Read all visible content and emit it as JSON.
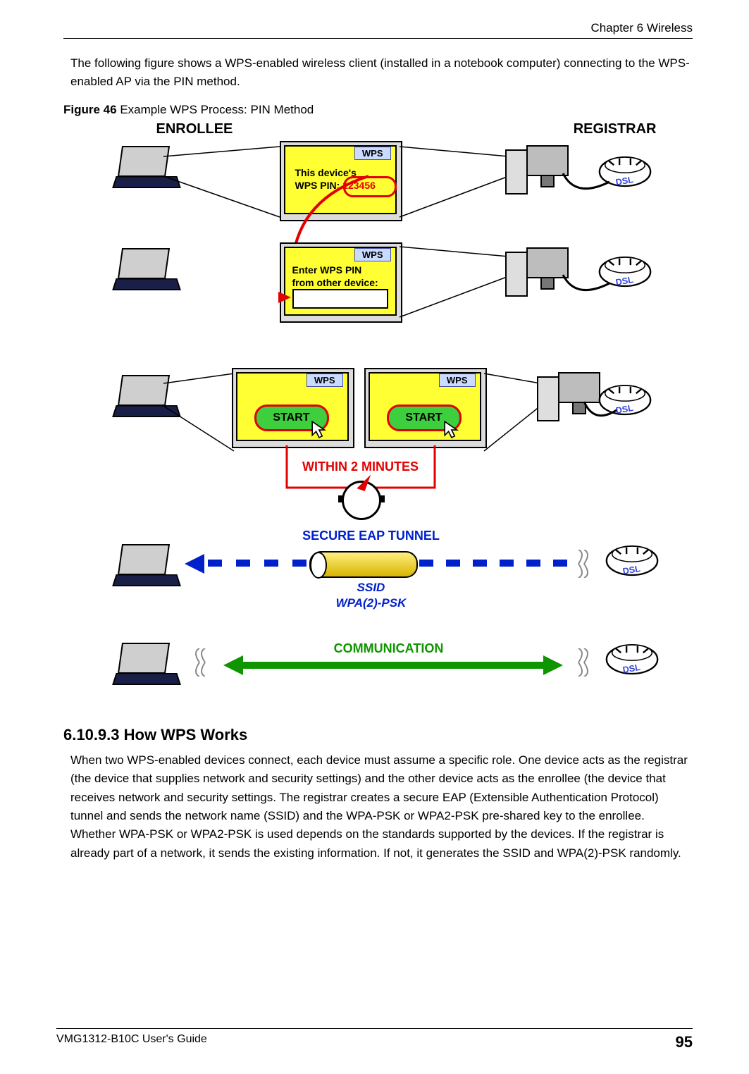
{
  "header": {
    "chapterline": "Chapter 6 Wireless"
  },
  "intro": "The following figure shows a WPS-enabled wireless client (installed in a notebook computer) connecting to the WPS-enabled AP via the PIN method.",
  "figure": {
    "caption_bold": "Figure 46",
    "caption_rest": "   Example WPS Process: PIN Method",
    "enrollee": "ENROLLEE",
    "registrar": "REGISTRAR",
    "dsl": "DSL",
    "wpsTab": "WPS",
    "screen1_line1": "This device's",
    "screen1_line2a": "WPS PIN: ",
    "screen1_pin": "123456",
    "screen2_line1": "Enter WPS PIN",
    "screen2_line2": "from other device:",
    "start": "START",
    "within": "WITHIN 2 MINUTES",
    "secure": "SECURE EAP TUNNEL",
    "ssid": "SSID",
    "wpa": "WPA(2)-PSK",
    "communication": "COMMUNICATION"
  },
  "section": {
    "num_title": "6.10.9.3  How WPS Works",
    "body": "When two WPS-enabled devices connect, each device must assume a specific role. One device acts as the registrar (the device that supplies network and security settings) and the other device acts as the enrollee (the device that receives network and security settings. The registrar creates a secure EAP (Extensible Authentication Protocol) tunnel and sends the network name (SSID) and the WPA-PSK or WPA2-PSK pre-shared key to the enrollee. Whether WPA-PSK or WPA2-PSK is used depends on the standards supported by the devices. If the registrar is already part of a network, it sends the existing information. If not, it generates the SSID and WPA(2)-PSK randomly."
  },
  "footer": {
    "guide": "VMG1312-B10C User's Guide",
    "page": "95"
  }
}
